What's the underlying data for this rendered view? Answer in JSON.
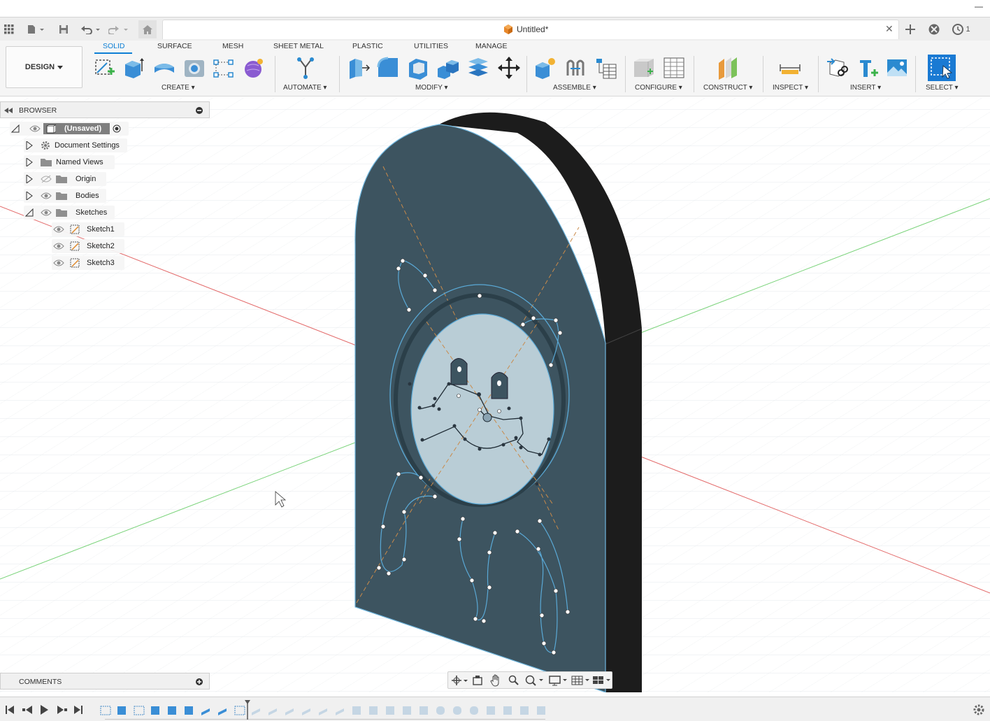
{
  "window": {
    "minimize_glyph": "—"
  },
  "app_bar": {
    "document_title": "Untitled*",
    "close_glyph": "✕",
    "job_count": "1"
  },
  "toolbar": {
    "workspace_label": "DESIGN",
    "tabs": [
      "SOLID",
      "SURFACE",
      "MESH",
      "SHEET METAL",
      "PLASTIC",
      "UTILITIES",
      "MANAGE"
    ],
    "active_tab": "SOLID",
    "groups": [
      "CREATE",
      "AUTOMATE",
      "MODIFY",
      "ASSEMBLE",
      "CONFIGURE",
      "CONSTRUCT",
      "INSPECT",
      "INSERT",
      "SELECT"
    ],
    "accent_color": "#0d7fd5"
  },
  "browser": {
    "title": "BROWSER",
    "root_label": "(Unsaved)",
    "items": [
      {
        "label": "Document Settings",
        "icon": "gear-icon"
      },
      {
        "label": "Named Views",
        "icon": "folder-icon"
      },
      {
        "label": "Origin",
        "icon": "folder-icon"
      },
      {
        "label": "Bodies",
        "icon": "folder-icon"
      },
      {
        "label": "Sketches",
        "icon": "folder-icon"
      }
    ],
    "sketches": [
      "Sketch1",
      "Sketch2",
      "Sketch3"
    ]
  },
  "comments": {
    "title": "COMMENTS"
  },
  "colors": {
    "body_face": "#3d5460",
    "body_side": "#1c1c1c",
    "sketch_fill": "#b9cdd6",
    "sketch_line": "#5aa9d6",
    "x_axis": "#e05555",
    "y_axis": "#66cc66"
  }
}
